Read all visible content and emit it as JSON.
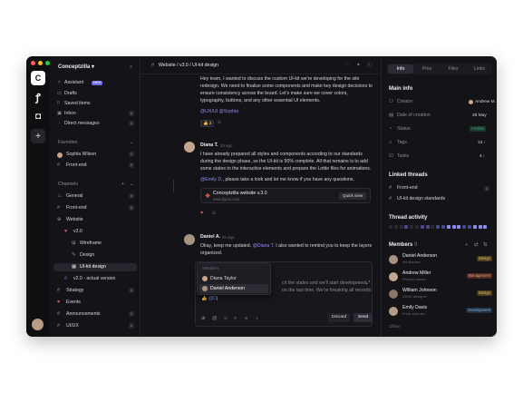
{
  "workspace": "Conceptzilla",
  "sidebar": {
    "top": [
      {
        "label": "Assistant",
        "badge": "NEW",
        "icon": "sparkle-icon"
      },
      {
        "label": "Drafts",
        "icon": "file-icon"
      },
      {
        "label": "Saved items",
        "icon": "bookmark-icon"
      },
      {
        "label": "Inbox",
        "count": "4",
        "icon": "inbox-icon"
      },
      {
        "label": "Direct messages",
        "count": "1",
        "icon": "message-icon"
      }
    ],
    "favorites_title": "Favorites",
    "favorites": [
      {
        "label": "Sophia Wilson",
        "count": "1"
      },
      {
        "label": "Front-end",
        "count": "2"
      }
    ],
    "channels_title": "Channels",
    "channels": [
      {
        "label": "General",
        "count": "4"
      },
      {
        "label": "Front-end",
        "count": "2"
      },
      {
        "label": "Website"
      },
      {
        "label": "v3.0"
      },
      {
        "label": "Wireframe"
      },
      {
        "label": "Design"
      },
      {
        "label": "UI-kit design"
      },
      {
        "label": "v2.0 - actual version"
      },
      {
        "label": "Strategy",
        "count": "1"
      },
      {
        "label": "Events"
      },
      {
        "label": "Announcements",
        "count": "1"
      },
      {
        "label": "UI/UX",
        "count": "1"
      }
    ]
  },
  "header": {
    "crumb1": "Website",
    "crumb2": "v3.0",
    "crumb3": "UI-kit design"
  },
  "messages": {
    "m1_text": "Hey team, I wanted to discuss the custom UI-kit we're developing for the site redesign. We need to finalize some components and make key design decisions to ensure consistency across the board. Let's make sure we cover colors, typography, buttons, and any other essential UI elements.",
    "m1_tags": "@UX/UI @Sophia",
    "m1_reaction": "2",
    "m2_author": "Diana T.",
    "m2_time": "2h ago",
    "m2_text": "I have already prepared all styles and components according to our standards during the design phase, so the UI-kit is 90% complete. All that remains is to add some states to the interactive elements and prepare the Lottie files for animations.",
    "m2_mention": "@Emily D.",
    "m2_text2": ", please take a look and let me know if you have any questions.",
    "file_name": "Conceptzilla website v.3.0",
    "file_url": "www.figma.com",
    "quick_view": "Quick view",
    "m3_author": "Daniel A.",
    "m3_time": "2h ago",
    "m3_text1": "Okay, keep me updated. ",
    "m3_mention": "@Diana T.",
    "m3_text2": " I also wanted to remind you to keep the layers organized."
  },
  "mention_popup": {
    "title": "Members",
    "items": [
      "Diana Taylor",
      "Daniel Anderson"
    ]
  },
  "composer": {
    "line1": "ch the states and we'll start development.",
    "line2": "on the last time. We're breaking all records",
    "typed": "@D",
    "discard": "Discard",
    "send": "Send"
  },
  "right": {
    "tabs": [
      "Info",
      "Pins",
      "Files",
      "Links"
    ],
    "main_info": "Main info",
    "info": [
      {
        "label": "Creator",
        "value": "Andrew M."
      },
      {
        "label": "Date of creation",
        "value": "28 May"
      },
      {
        "label": "Status",
        "value": "Active"
      },
      {
        "label": "Tags",
        "value": "13"
      },
      {
        "label": "Tasks",
        "value": "4"
      }
    ],
    "linked_title": "Linked threads",
    "linked": [
      {
        "label": "Front-end",
        "count": "1"
      },
      {
        "label": "UI-kit design standards"
      }
    ],
    "activity_title": "Thread activity",
    "members_title": "Members",
    "members_count": "9",
    "members": [
      {
        "name": "Daniel Anderson",
        "role": "Art director",
        "tag": "Design"
      },
      {
        "name": "Andrew Miller",
        "role": "Product owner",
        "tag": "Management"
      },
      {
        "name": "William Johnson",
        "role": "UX/UI designer",
        "tag": "Design"
      },
      {
        "name": "Emily Davis",
        "role": "Front-end dev",
        "tag": "Development"
      }
    ],
    "offline": "Offline"
  },
  "colors": {
    "accent": "#6f6af0",
    "active": "#3fb27f",
    "bg": "#141418"
  }
}
